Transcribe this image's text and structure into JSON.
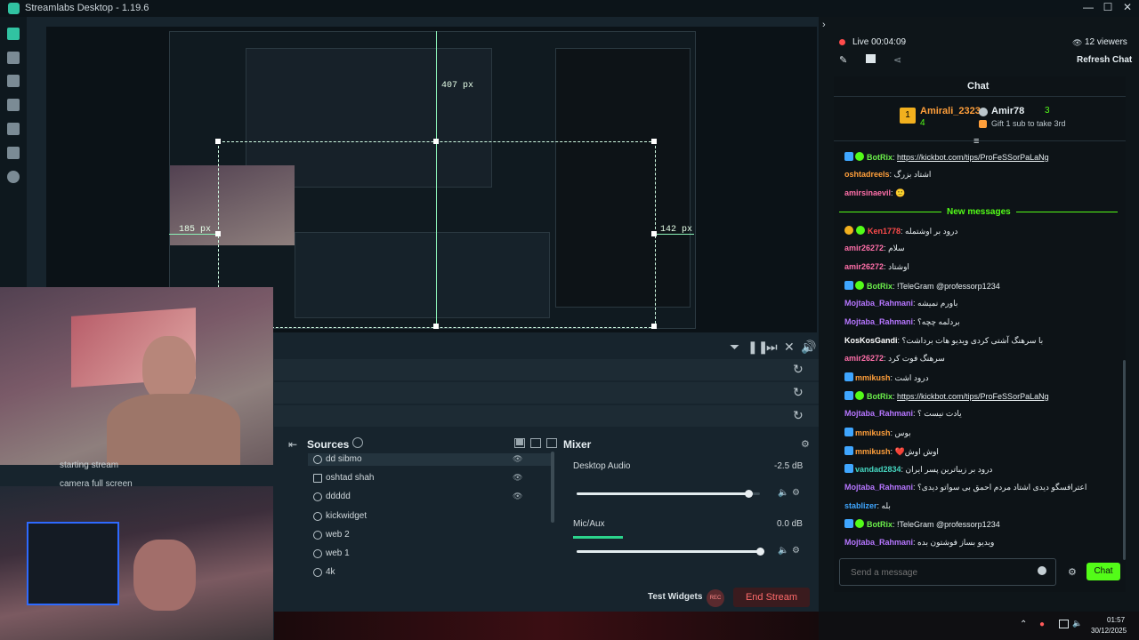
{
  "window": {
    "title": "Streamlabs Desktop - 1.19.6",
    "controls": [
      "—",
      "☐",
      "✕"
    ]
  },
  "nav_icons": [
    "editor-icon",
    "dashboard-icon",
    "layout-icon",
    "themes-icon",
    "store-icon",
    "highlighter-icon",
    "recording-icon",
    "settings-icon"
  ],
  "preview": {
    "measure_top": "407 px",
    "measure_left": "185 px",
    "measure_right": "142 px"
  },
  "scene_overlay": {
    "item1": "starting stream",
    "item2": "camera full screen"
  },
  "sources": {
    "title": "Sources",
    "items": [
      {
        "label": "dd sibmo",
        "icon": "globe-icon"
      },
      {
        "label": "oshtad shah",
        "icon": "image-icon"
      },
      {
        "label": "ddddd",
        "icon": "globe-icon"
      },
      {
        "label": "kickwidget",
        "icon": "globe-icon"
      },
      {
        "label": "web 2",
        "icon": "camera-icon"
      },
      {
        "label": "web 1",
        "icon": "camera-icon"
      },
      {
        "label": "4k",
        "icon": "globe-icon"
      }
    ]
  },
  "mixer": {
    "title": "Mixer",
    "channels": [
      {
        "label": "Desktop Audio",
        "db": "-2.5 dB",
        "level": 0.94
      },
      {
        "label": "Mic/Aux",
        "db": "0.0 dB",
        "level": 1.0
      }
    ]
  },
  "footer": {
    "test_widgets": "Test Widgets",
    "rec": "REC",
    "end_stream": "End Stream"
  },
  "chat": {
    "live_label": "Live",
    "live_time": "00:04:09",
    "viewers": "12 viewers",
    "refresh": "Refresh Chat",
    "header": "Chat",
    "leader1_name": "Amirali_2323",
    "leader1_rank": "1",
    "leader1_count": "4",
    "leader2_name": "Amir78",
    "leader2_count": "3",
    "leader2_sub": "Gift 1 sub to take 3rd",
    "new_messages": "New messages",
    "input_placeholder": "Send a message",
    "send_button": "Chat",
    "messages": [
      {
        "user": "BotRix",
        "color": "u-green",
        "bot": true,
        "text": "https://kickbot.com/tips/ProFeSSorPaLaNg",
        "link": true
      },
      {
        "user": "oshtadreels",
        "color": "u-orange",
        "bot": false,
        "text": "اشتاد بزرگ"
      },
      {
        "user": "amirsinaevil",
        "color": "u-pink",
        "bot": false,
        "text": "🙂"
      },
      {
        "user": "Ken1778",
        "color": "u-red",
        "bot": false,
        "text": "درود بر اوشتمله"
      },
      {
        "user": "amir26272",
        "color": "u-pink",
        "bot": false,
        "text": "سلام"
      },
      {
        "user": "amir26272",
        "color": "u-pink",
        "bot": false,
        "text": "اوشتاد"
      },
      {
        "user": "BotRix",
        "color": "u-green",
        "bot": true,
        "text": "!TeleGram @professorp1234"
      },
      {
        "user": "Mojtaba_Rahmani",
        "color": "u-purple",
        "bot": false,
        "text": "باورم نمیشه"
      },
      {
        "user": "Mojtaba_Rahmani",
        "color": "u-purple",
        "bot": false,
        "text": "بردلمه چچه؟"
      },
      {
        "user": "KosKosGandi",
        "color": "u-white",
        "bot": false,
        "text": "با سرهنگ آشتی کردی ویدیو هات برداشت؟"
      },
      {
        "user": "amir26272",
        "color": "u-pink",
        "bot": false,
        "text": "سرهنگ فوت کرد"
      },
      {
        "user": "mmikush",
        "color": "u-orange",
        "bot": true,
        "text": "درود اشت"
      },
      {
        "user": "BotRix",
        "color": "u-green",
        "bot": true,
        "text": "https://kickbot.com/tips/ProFeSSorPaLaNg",
        "link": true
      },
      {
        "user": "Mojtaba_Rahmani",
        "color": "u-purple",
        "bot": false,
        "text": "یادت نیست ؟"
      },
      {
        "user": "mmikush",
        "color": "u-orange",
        "bot": true,
        "text": "بوس"
      },
      {
        "user": "mmikush",
        "color": "u-orange",
        "bot": true,
        "text": "❤️اوش اوش"
      },
      {
        "user": "vandad2834",
        "color": "u-teal",
        "bot": true,
        "text": "درود بر زیباترین پسر ایران"
      },
      {
        "user": "Mojtaba_Rahmani",
        "color": "u-purple",
        "bot": false,
        "text": "اعترافسگو دیدی اشتاد مردم احمق بی سواتو دیدی؟"
      },
      {
        "user": "stablizer",
        "color": "u-blue",
        "bot": false,
        "text": "بله"
      },
      {
        "user": "BotRix",
        "color": "u-green",
        "bot": true,
        "text": "!TeleGram @professorp1234"
      },
      {
        "user": "Mojtaba_Rahmani",
        "color": "u-purple",
        "bot": false,
        "text": "ویدیو بساز فوشتون بده"
      }
    ]
  },
  "taskbar": {
    "time": "01:57",
    "date": "30/12/2025"
  }
}
